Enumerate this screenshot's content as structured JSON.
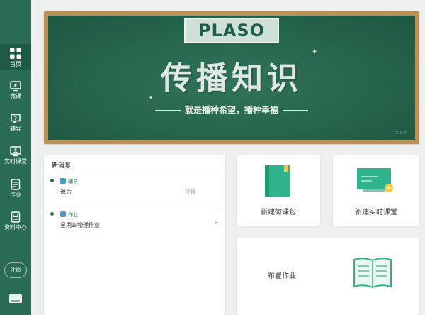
{
  "sidebar": {
    "items": [
      {
        "label": "首页",
        "icon": "grid-icon"
      },
      {
        "label": "微课",
        "icon": "video-icon"
      },
      {
        "label": "辅导",
        "icon": "question-icon"
      },
      {
        "label": "实时课堂",
        "icon": "classroom-icon"
      },
      {
        "label": "作业",
        "icon": "homework-icon"
      },
      {
        "label": "资料中心",
        "icon": "folder-icon"
      }
    ],
    "logout_label": "注销",
    "bottom_icon": "keyboard-icon"
  },
  "banner": {
    "logo": "PLASO",
    "slogan": "传播知识",
    "subslogan": "就是播种希望，播种幸福",
    "signature": "X.X.Y"
  },
  "news": {
    "title": "新消息",
    "items": [
      {
        "category": "辅导",
        "text": "课后",
        "side": "注释"
      },
      {
        "category": "作业",
        "text": "星期四物理作业",
        "side": "›"
      }
    ]
  },
  "actions": {
    "micro_lesson": "新建微课包",
    "live_class": "新建实时课堂",
    "assign_homework": "布置作业"
  },
  "colors": {
    "sidebar": "#2a6b58",
    "chalkboard": "#246b4f",
    "frame": "#b98f5a"
  }
}
